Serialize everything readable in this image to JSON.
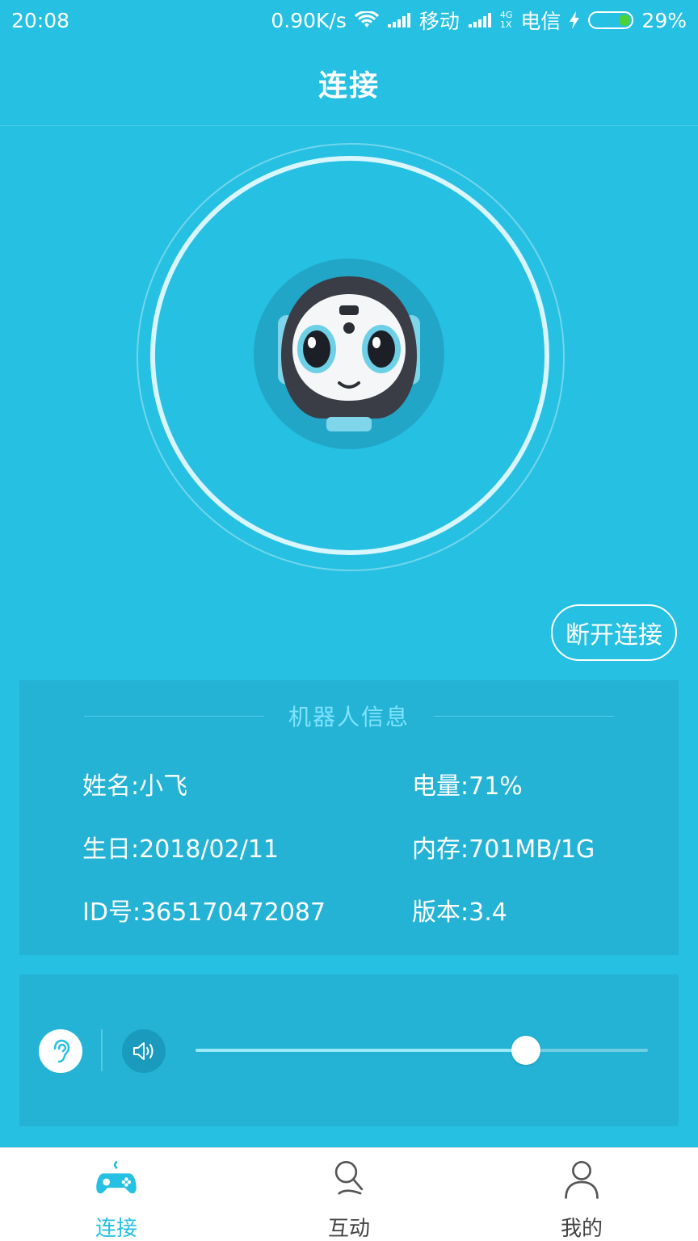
{
  "status_bar": {
    "time": "20:08",
    "speed": "0.90K/s",
    "carrier1": "移动",
    "net_top": "4G",
    "net_bottom": "1X",
    "carrier2": "电信",
    "battery": "29%",
    "battery_level": 0.29
  },
  "header": {
    "title": "连接"
  },
  "disconnect_label": "断开连接",
  "robot_info": {
    "title": "机器人信息",
    "name": "姓名:小飞",
    "battery": "电量:71%",
    "birthday": "生日:2018/02/11",
    "memory": "内存:701MB/1G",
    "id": "ID号:365170472087",
    "version": "版本:3.4"
  },
  "volume": {
    "level": 0.73
  },
  "tabs": [
    {
      "label": "连接",
      "icon": "gamepad-icon",
      "active": true
    },
    {
      "label": "互动",
      "icon": "microphone-icon",
      "active": false
    },
    {
      "label": "我的",
      "icon": "user-icon",
      "active": false
    }
  ],
  "colors": {
    "background": "#26c0e2",
    "card": "#24b3d5",
    "accent": "#26c0e2",
    "battery": "#4cd137"
  }
}
